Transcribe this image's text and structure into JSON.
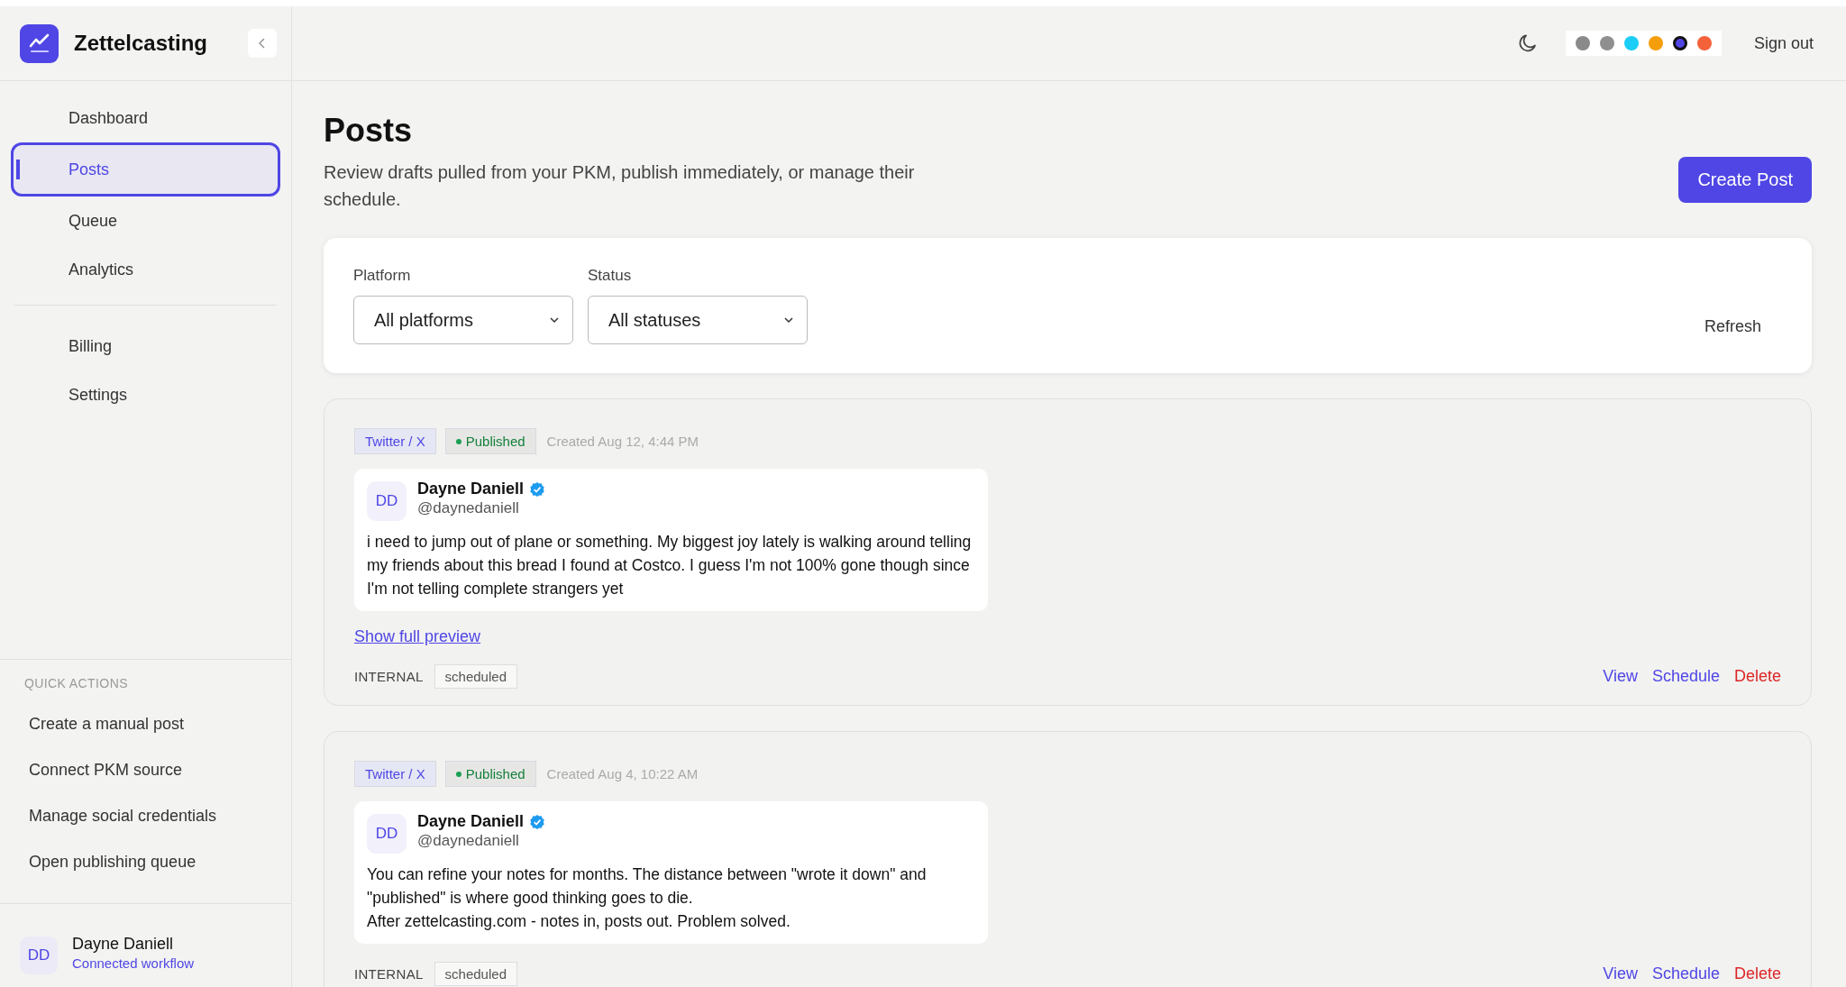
{
  "sidebar": {
    "brand": "Zettelcasting",
    "nav": [
      {
        "label": "Dashboard",
        "selected": false
      },
      {
        "label": "Posts",
        "selected": true
      },
      {
        "label": "Queue",
        "selected": false
      },
      {
        "label": "Analytics",
        "selected": false
      }
    ],
    "nav_secondary": [
      {
        "label": "Billing",
        "selected": false
      },
      {
        "label": "Settings",
        "selected": false
      }
    ],
    "quick_actions": {
      "title": "QUICK ACTIONS",
      "items": [
        "Create a manual post",
        "Connect PKM source",
        "Manage social credentials",
        "Open publishing queue"
      ]
    },
    "user": {
      "initials": "DD",
      "name": "Dayne Daniell",
      "subtitle": "Connected workflow"
    }
  },
  "top_bar": {
    "swatches": [
      {
        "color": "#8a8a8a",
        "selected": false
      },
      {
        "color": "#8f8f8f",
        "selected": false
      },
      {
        "color": "#1ccdf5",
        "selected": false
      },
      {
        "color": "#f59e0b",
        "selected": false
      },
      {
        "color": "#5046e5",
        "selected": true
      },
      {
        "color": "#f4623a",
        "selected": false
      }
    ],
    "sign_out": "Sign out"
  },
  "page": {
    "title": "Posts",
    "subtitle": "Review drafts pulled from your PKM, publish immediately, or manage their schedule.",
    "create_button": "Create Post"
  },
  "filters": {
    "platform": {
      "label": "Platform",
      "value": "All platforms"
    },
    "status": {
      "label": "Status",
      "value": "All statuses"
    },
    "refresh": "Refresh"
  },
  "posts": [
    {
      "platform": "Twitter / X",
      "status": "Published",
      "created": "Created Aug 12, 4:44 PM",
      "author": {
        "initials": "DD",
        "name": "Dayne Daniell",
        "handle": "@daynedaniell",
        "verified": true
      },
      "body": "i need to jump out of plane or something. My biggest joy lately is walking around telling my friends about this bread I found at Costco. I guess I'm not 100% gone though since I'm not telling complete strangers yet",
      "show_full_preview": "Show full preview",
      "internal_label": "INTERNAL",
      "internal_status": "scheduled",
      "actions": [
        {
          "label": "View",
          "kind": "link"
        },
        {
          "label": "Schedule",
          "kind": "link"
        },
        {
          "label": "Delete",
          "kind": "danger"
        }
      ]
    },
    {
      "platform": "Twitter / X",
      "status": "Published",
      "created": "Created Aug 4, 10:22 AM",
      "author": {
        "initials": "DD",
        "name": "Dayne Daniell",
        "handle": "@daynedaniell",
        "verified": true
      },
      "body": "You can refine your notes for months. The distance between \"wrote it down\" and \"published\" is where good thinking goes to die.\nAfter zettelcasting.com - notes in, posts out. Problem solved.",
      "internal_label": "INTERNAL",
      "internal_status": "scheduled",
      "actions": [
        {
          "label": "View",
          "kind": "link"
        },
        {
          "label": "Schedule",
          "kind": "link"
        },
        {
          "label": "Delete",
          "kind": "danger"
        }
      ]
    }
  ]
}
